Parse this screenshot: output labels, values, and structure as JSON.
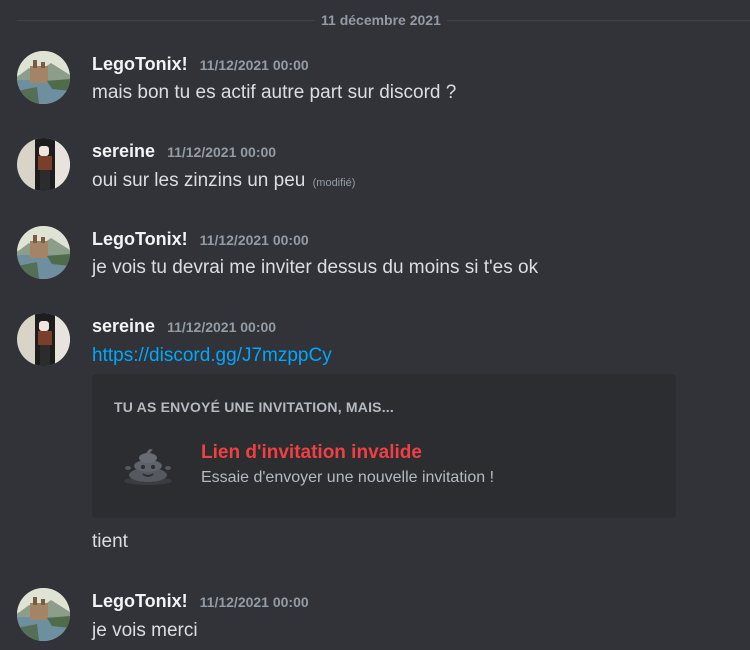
{
  "date_divider": "11 décembre 2021",
  "messages": [
    {
      "author": "LegoTonix!",
      "timestamp": "11/12/2021 00:00",
      "text": "mais bon tu es actif autre part sur discord ?",
      "avatar": "castle-lake-avatar"
    },
    {
      "author": "sereine",
      "timestamp": "11/12/2021 00:00",
      "text": "oui sur les zinzins un peu",
      "edited": "(modifié)",
      "avatar": "character-avatar"
    },
    {
      "author": "LegoTonix!",
      "timestamp": "11/12/2021 00:00",
      "text": "je vois tu devrai me inviter dessus du moins si t'es ok",
      "avatar": "castle-lake-avatar"
    },
    {
      "author": "sereine",
      "timestamp": "11/12/2021 00:00",
      "link": "https://discord.gg/J7mzppCy",
      "followup": "tient",
      "avatar": "character-avatar"
    },
    {
      "author": "LegoTonix!",
      "timestamp": "11/12/2021 00:00",
      "text": "je vois merci",
      "avatar": "castle-lake-avatar"
    }
  ],
  "invite_embed": {
    "header": "TU AS ENVOYÉ UNE INVITATION, MAIS...",
    "title": "Lien d'invitation invalide",
    "subtitle": "Essaie d'envoyer une nouvelle invitation !",
    "icon": "poop-icon"
  },
  "colors": {
    "background": "#313338",
    "embed_background": "#2b2d31",
    "link": "#00a8fc",
    "error": "#f23f42",
    "muted": "#949ba4"
  }
}
